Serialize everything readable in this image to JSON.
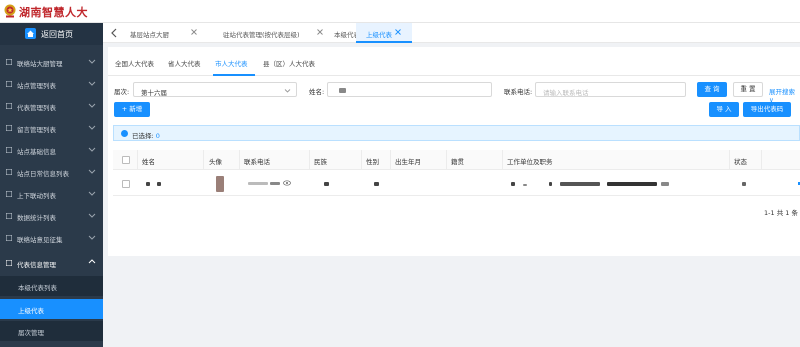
{
  "app": {
    "title": "湖南智慧人大"
  },
  "sidebar": {
    "home_label": "返回首页",
    "items": [
      {
        "label": "联络站大厨管理"
      },
      {
        "label": "站点管理列表"
      },
      {
        "label": "代表管理列表"
      },
      {
        "label": "留言管理列表"
      },
      {
        "label": "站点基础信息"
      },
      {
        "label": "站点日常信息列表"
      },
      {
        "label": "上下联动列表"
      },
      {
        "label": "数据统计列表"
      },
      {
        "label": "联络站意见征集"
      },
      {
        "label": "代表信息管理"
      }
    ],
    "sub_items": [
      {
        "label": "本级代表列表"
      },
      {
        "label": "上级代表"
      },
      {
        "label": "届次管理"
      }
    ]
  },
  "tabs": [
    {
      "label": "基层站点大厨"
    },
    {
      "label": "驻站代表管理(按代表层级)"
    },
    {
      "label": "本级代表列表"
    },
    {
      "label": "上级代表"
    }
  ],
  "subtabs": [
    {
      "label": "全国人大代表"
    },
    {
      "label": "省人大代表"
    },
    {
      "label": "市人大代表"
    },
    {
      "label": "县（区）人大代表"
    }
  ],
  "filters": {
    "session_label": "届次:",
    "session_value": "第十六届",
    "name_label": "姓名:",
    "phone_label": "联系电话:",
    "phone_placeholder": "请输入联系电话",
    "query_btn": "查 询",
    "reset_btn": "重 置",
    "expand_link": "展开搜索 ∨"
  },
  "toolbar": {
    "add_btn": "+ 新增",
    "import_btn": "导 入",
    "export_btn": "导出代表码"
  },
  "alert": {
    "label": "已选择:",
    "count": "0"
  },
  "table": {
    "columns": [
      "姓名",
      "头像",
      "联系电话",
      "民族",
      "性别",
      "出生年月",
      "籍贯",
      "工作单位及职务",
      "状态"
    ]
  },
  "pager": {
    "text": "1-1 共 1 条"
  },
  "colors": {
    "accent": "#1890ff",
    "sidebar_bg": "#2b3a4a",
    "brand_red": "#c0282d"
  }
}
